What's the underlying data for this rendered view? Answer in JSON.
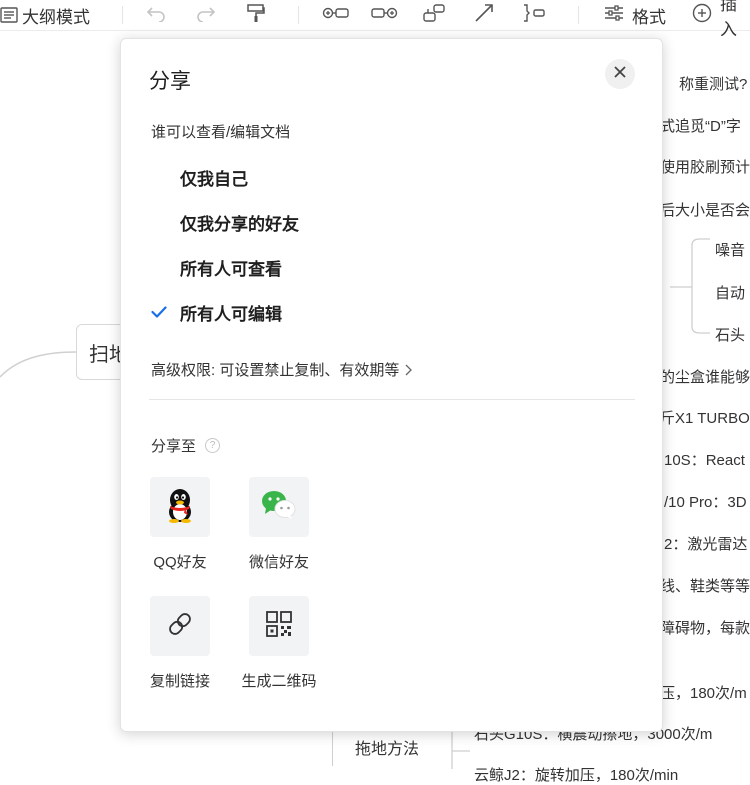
{
  "toolbar": {
    "outline_mode_label": "大纲模式",
    "format_label": "格式",
    "insert_label": "插入"
  },
  "mindmap": {
    "root_node": "扫地",
    "node_method": "拖地方法",
    "right_texts": [
      "称重测试?",
      "式追觅“D”字",
      "使用胶刷预计",
      "后大小是否会",
      "噪音",
      "自动",
      "石头",
      "的尘盒谁能够",
      "斤X1 TURBO",
      "10S：React",
      "/10 Pro：3D",
      "2：激光雷达",
      "线、鞋类等等",
      "障碍物，每款",
      "压，180次/m",
      "石头G10S：横震动擦地，3000次/m",
      "云鲸J2：旋转加压，180次/min"
    ]
  },
  "dialog": {
    "title": "分享",
    "permission_heading": "谁可以查看/编辑文档",
    "options": [
      {
        "label": "仅我自己",
        "selected": false
      },
      {
        "label": "仅我分享的好友",
        "selected": false
      },
      {
        "label": "所有人可查看",
        "selected": false
      },
      {
        "label": "所有人可编辑",
        "selected": true
      }
    ],
    "advanced_link": "高级权限: 可设置禁止复制、有效期等",
    "share_heading": "分享至",
    "help_glyph": "?",
    "targets": [
      {
        "label": "QQ好友",
        "icon": "qq-penguin-icon"
      },
      {
        "label": "微信好友",
        "icon": "wechat-icon"
      },
      {
        "label": "复制链接",
        "icon": "link-icon"
      },
      {
        "label": "生成二维码",
        "icon": "qr-code-icon"
      }
    ]
  },
  "colors": {
    "check": "#1a6fe8",
    "tile_bg": "#f2f3f5",
    "qq_red": "#e8231b",
    "wechat_green": "#39b54a"
  }
}
